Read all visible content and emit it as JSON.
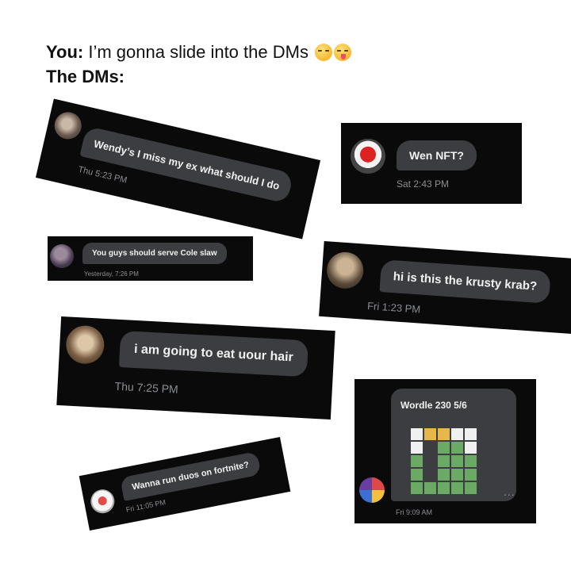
{
  "caption": {
    "line1_label": "You:",
    "line1_text": " I’m gonna slide into the DMs ",
    "line1_emoji": [
      "smirk-emoji",
      "zany-face-emoji"
    ],
    "line2_label": "The DMs:"
  },
  "dms": [
    {
      "message": "Wendy’s I miss my ex what should I do",
      "time": "Thu 5:23 PM"
    },
    {
      "message": "Wen NFT?",
      "time": "Sat 2:43 PM"
    },
    {
      "message": "You guys should serve Cole slaw",
      "time": "Yesterday, 7:26 PM"
    },
    {
      "message": "hi is this the krusty krab?",
      "time": "Fri 1:23 PM"
    },
    {
      "message": "i am going to eat uour hair",
      "time": "Thu 7:25 PM"
    },
    {
      "message": "Wanna run duos on fortnite?",
      "time": "Fri 11:05 PM"
    },
    {
      "message": "Wordle 230 5/6",
      "time": "Fri 9:09 AM",
      "more": "...",
      "grid": [
        [
          "w",
          "y",
          "y",
          "w",
          "w"
        ],
        [
          "w",
          "d",
          "g",
          "g",
          "w"
        ],
        [
          "g",
          "d",
          "g",
          "g",
          "g"
        ],
        [
          "g",
          "d",
          "g",
          "g",
          "g"
        ],
        [
          "g",
          "g",
          "g",
          "g",
          "g"
        ]
      ]
    }
  ],
  "colors": {
    "card_bg": "#0a0a0a",
    "bubble_bg": "#3b3d41",
    "wordle_green": "#6aaa64",
    "wordle_yellow": "#e6b84c"
  }
}
